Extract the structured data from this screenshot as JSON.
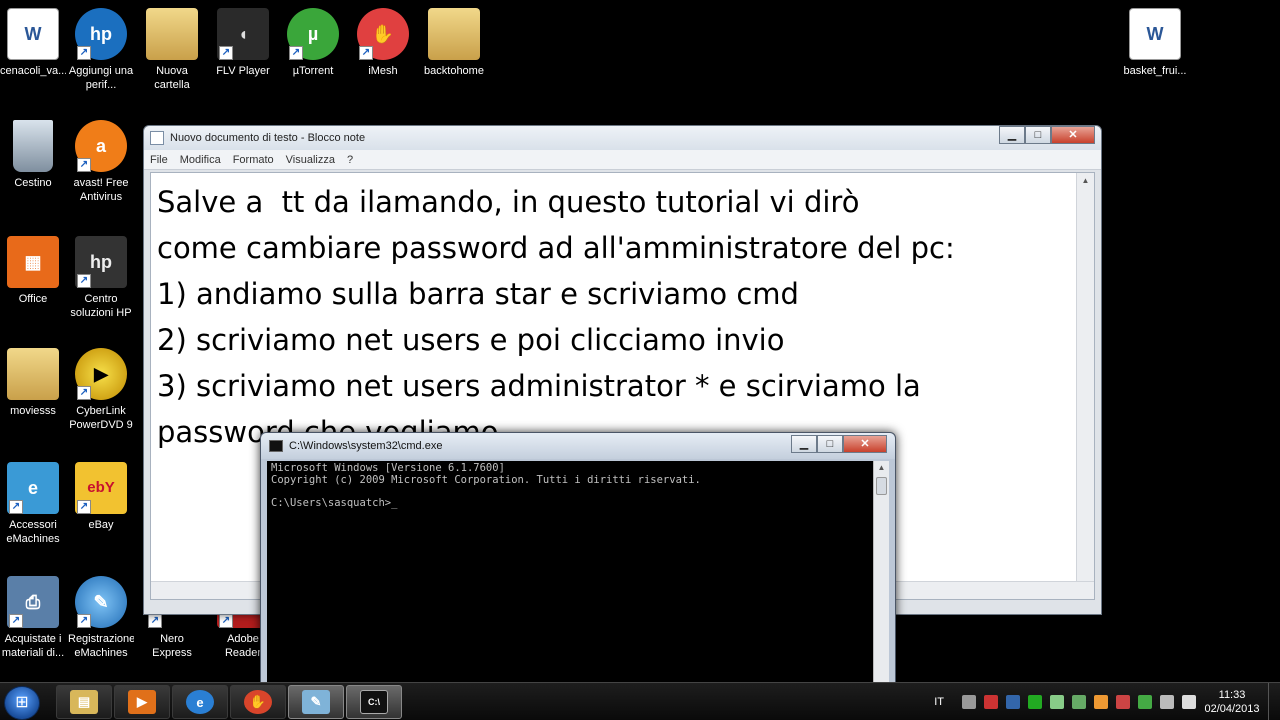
{
  "desktop": {
    "icons": [
      {
        "label": "cenacoli_va...",
        "icon": "word-document-icon",
        "color": "#2b5797"
      },
      {
        "label": "Aggiungi una perif...",
        "icon": "hp-icon",
        "color": "#1b6fbf"
      },
      {
        "label": "Nuova cartella",
        "icon": "folder-icon",
        "color": "#d8b75a"
      },
      {
        "label": "FLV Player",
        "icon": "speaker-icon",
        "color": "#333333"
      },
      {
        "label": "µTorrent",
        "icon": "utorrent-icon",
        "color": "#3aa63a"
      },
      {
        "label": "iMesh",
        "icon": "imesh-icon",
        "color": "#e04040"
      },
      {
        "label": "backtohome",
        "icon": "folder-icon",
        "color": "#d8b75a"
      },
      {
        "label": "basket_frui...",
        "icon": "word-document-icon",
        "color": "#2b5797"
      },
      {
        "label": "Cestino",
        "icon": "recycle-bin-icon",
        "color": "#6f7f8f"
      },
      {
        "label": "avast! Free Antivirus",
        "icon": "avast-icon",
        "color": "#f07d18"
      },
      {
        "label": "Office",
        "icon": "office-icon",
        "color": "#e86a1a"
      },
      {
        "label": "Centro soluzioni HP",
        "icon": "hp-icon",
        "color": "#444444"
      },
      {
        "label": "moviesss",
        "icon": "folder-icon",
        "color": "#d8b75a"
      },
      {
        "label": "CyberLink PowerDVD 9",
        "icon": "powerdvd-icon",
        "color": "#e8c010"
      },
      {
        "label": "Accessori eMachines",
        "icon": "emachines-icon",
        "color": "#3a9ad6"
      },
      {
        "label": "eBay",
        "icon": "ebay-icon",
        "color": "#f2c230"
      },
      {
        "label": "Acquistate i materiali di...",
        "icon": "printer-icon",
        "color": "#5a7fa8"
      },
      {
        "label": "Registrazione eMachines",
        "icon": "registration-icon",
        "color": "#2f86d1"
      },
      {
        "label": "Nero Express",
        "icon": "nero-icon",
        "color": "#222222"
      },
      {
        "label": "Adobe Reader",
        "icon": "adobe-reader-icon",
        "color": "#b31d1d"
      }
    ]
  },
  "notepad": {
    "title": "Nuovo documento di testo - Blocco note",
    "menu": [
      "File",
      "Modifica",
      "Formato",
      "Visualizza",
      "?"
    ],
    "content": "Salve a  tt da ilamando, in questo tutorial vi dirò\ncome cambiare password ad all'amministratore del pc:\n1) andiamo sulla barra star e scriviamo cmd\n2) scriviamo net users e poi clicciamo invio\n3) scriviamo net users administrator * e scirviamo la\npassword che vogliamo"
  },
  "cmd": {
    "title": "C:\\Windows\\system32\\cmd.exe",
    "output": "Microsoft Windows [Versione 6.1.7600]\nCopyright (c) 2009 Microsoft Corporation. Tutti i diritti riservati.\n\nC:\\Users\\sasquatch>_"
  },
  "window_buttons": {
    "minimize": "▁",
    "maximize": "□",
    "close": "✕"
  },
  "taskbar": {
    "start_glyph": "⊞",
    "pinned": [
      {
        "name": "explorer",
        "icon": "folder-icon",
        "glyph": "▤",
        "color": "#d8b75a"
      },
      {
        "name": "media-player",
        "icon": "media-player-icon",
        "glyph": "▶",
        "color": "#e0701a"
      },
      {
        "name": "internet-explorer",
        "icon": "ie-icon",
        "glyph": "e",
        "color": "#2a7fd4"
      },
      {
        "name": "imesh",
        "icon": "imesh-icon",
        "glyph": "✋",
        "color": "#d9452b"
      },
      {
        "name": "notepad",
        "icon": "notepad-icon",
        "glyph": "✎",
        "color": "#7fb3d8"
      },
      {
        "name": "cmd",
        "icon": "cmd-icon",
        "glyph": "C:\\",
        "color": "#111111"
      }
    ],
    "tray": {
      "language": "IT",
      "time": "11:33",
      "date": "02/04/2013"
    }
  }
}
